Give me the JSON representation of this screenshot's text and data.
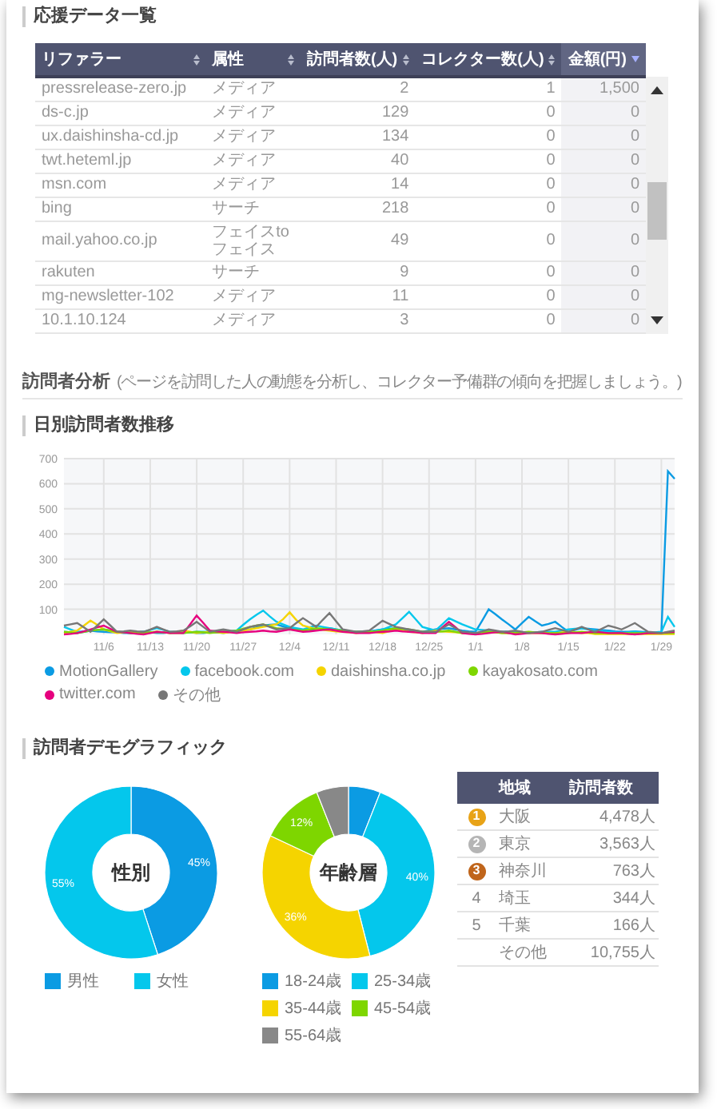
{
  "support_section": {
    "title": "応援データ一覧",
    "columns": [
      {
        "label": "リファラー",
        "sorted": false
      },
      {
        "label": "属性",
        "sorted": false
      },
      {
        "label": "訪問者数(人)",
        "sorted": false
      },
      {
        "label": "コレクター数(人)",
        "sorted": false
      },
      {
        "label": "金額(円)",
        "sorted": true
      }
    ],
    "rows": [
      [
        "pressrelease-zero.jp",
        "メディア",
        "2",
        "1",
        "1,500"
      ],
      [
        "ds-c.jp",
        "メディア",
        "129",
        "0",
        "0"
      ],
      [
        "ux.daishinsha-cd.jp",
        "メディア",
        "134",
        "0",
        "0"
      ],
      [
        "twt.heteml.jp",
        "メディア",
        "40",
        "0",
        "0"
      ],
      [
        "msn.com",
        "メディア",
        "14",
        "0",
        "0"
      ],
      [
        "bing",
        "サーチ",
        "218",
        "0",
        "0"
      ],
      [
        "mail.yahoo.co.jp",
        "フェイスtoフェイス",
        "49",
        "0",
        "0"
      ],
      [
        "rakuten",
        "サーチ",
        "9",
        "0",
        "0"
      ],
      [
        "mg-newsletter-102",
        "メディア",
        "11",
        "0",
        "0"
      ],
      [
        "10.1.10.124",
        "メディア",
        "3",
        "0",
        "0"
      ]
    ]
  },
  "visitor_analysis": {
    "title": "訪問者分析",
    "subtitle": "(ページを訪問した人の動態を分析し、コレクター予備群の傾向を把握しましょう。)",
    "daily_visitors": {
      "title": "日別訪問者数推移",
      "chart_data": {
        "type": "line",
        "categories": [
          null,
          null,
          null,
          null,
          null,
          null,
          "11/6",
          null,
          null,
          null,
          null,
          null,
          null,
          "11/13",
          null,
          null,
          null,
          null,
          null,
          null,
          "11/20",
          null,
          null,
          null,
          null,
          null,
          null,
          "11/27",
          null,
          null,
          null,
          null,
          null,
          null,
          "12/4",
          null,
          null,
          null,
          null,
          null,
          null,
          "12/11",
          null,
          null,
          null,
          null,
          null,
          null,
          "12/18",
          null,
          null,
          null,
          null,
          null,
          null,
          "12/25",
          null,
          null,
          null,
          null,
          null,
          null,
          "1/1",
          null,
          null,
          null,
          null,
          null,
          null,
          "1/8",
          null,
          null,
          null,
          null,
          null,
          null,
          "1/15",
          null,
          null,
          null,
          null,
          null,
          null,
          "1/22",
          null,
          null,
          null,
          null,
          null,
          null,
          "1/29",
          null,
          null
        ],
        "ylim": [
          0,
          700
        ],
        "yticks": [
          100,
          200,
          300,
          400,
          500,
          600,
          700
        ],
        "grid": true,
        "series": [
          {
            "name": "MotionGallery",
            "color": "#0b9be3",
            "values": [
              10,
              8,
              5,
              10,
              15,
              12,
              10,
              9,
              8,
              6,
              5,
              8,
              10,
              8,
              5,
              6,
              8,
              10,
              12,
              8,
              5,
              6,
              8,
              9,
              10,
              12,
              15,
              18,
              20,
              28,
              35,
              38,
              40,
              32,
              25,
              20,
              15,
              18,
              20,
              22,
              25,
              20,
              15,
              12,
              10,
              11,
              12,
              16,
              20,
              22,
              25,
              20,
              15,
              12,
              10,
              15,
              20,
              22,
              25,
              20,
              15,
              12,
              10,
              55,
              100,
              80,
              60,
              40,
              20,
              45,
              70,
              52,
              35,
              42,
              50,
              30,
              10,
              18,
              25,
              22,
              20,
              18,
              15,
              12,
              10,
              11,
              12,
              10,
              8,
              6,
              5,
              650,
              620
            ]
          },
          {
            "name": "facebook.com",
            "color": "#04c7ec",
            "values": [
              30,
              20,
              10,
              12,
              15,
              18,
              20,
              15,
              10,
              8,
              5,
              8,
              10,
              18,
              25,
              18,
              10,
              8,
              5,
              8,
              10,
              10,
              10,
              8,
              5,
              10,
              15,
              38,
              60,
              78,
              95,
              72,
              50,
              40,
              30,
              25,
              20,
              28,
              35,
              30,
              25,
              20,
              15,
              12,
              10,
              10,
              10,
              15,
              20,
              30,
              40,
              65,
              90,
              60,
              30,
              22,
              15,
              40,
              65,
              52,
              40,
              30,
              20,
              18,
              15,
              12,
              10,
              10,
              10,
              8,
              5,
              8,
              10,
              10,
              10,
              15,
              20,
              22,
              25,
              20,
              15,
              12,
              10,
              8,
              5,
              8,
              10,
              8,
              5,
              8,
              10,
              70,
              30
            ]
          },
          {
            "name": "daishinsha.co.jp",
            "color": "#f5d400",
            "values": [
              5,
              10,
              15,
              35,
              55,
              38,
              20,
              12,
              5,
              8,
              10,
              8,
              5,
              8,
              10,
              8,
              5,
              10,
              15,
              10,
              5,
              8,
              10,
              8,
              5,
              8,
              10,
              15,
              20,
              25,
              30,
              35,
              40,
              60,
              88,
              58,
              35,
              28,
              20,
              18,
              15,
              12,
              10,
              8,
              5,
              8,
              10,
              8,
              5,
              12,
              20,
              15,
              10,
              8,
              5,
              10,
              15,
              12,
              10,
              8,
              5,
              5,
              5,
              8,
              10,
              8,
              5,
              5,
              5,
              5,
              5,
              5,
              5,
              5,
              5,
              8,
              10,
              8,
              5,
              5,
              1,
              1,
              1,
              1,
              1,
              1,
              1,
              1,
              1,
              1,
              1,
              1,
              1
            ]
          },
          {
            "name": "kayakosato.com",
            "color": "#7ed600",
            "values": [
              10,
              8,
              5,
              10,
              15,
              18,
              20,
              15,
              10,
              8,
              5,
              5,
              5,
              8,
              10,
              8,
              5,
              5,
              5,
              8,
              10,
              8,
              5,
              8,
              10,
              12,
              15,
              22,
              30,
              35,
              40,
              32,
              25,
              22,
              20,
              18,
              15,
              20,
              25,
              22,
              20,
              18,
              15,
              12,
              10,
              10,
              10,
              12,
              15,
              20,
              25,
              22,
              20,
              15,
              10,
              10,
              10,
              12,
              15,
              10,
              5,
              5,
              5,
              8,
              10,
              8,
              5,
              5,
              5,
              8,
              10,
              8,
              5,
              5,
              5,
              5,
              5,
              8,
              10,
              8,
              5,
              5,
              5,
              5,
              5,
              5,
              5,
              5,
              5,
              5,
              5,
              5,
              5
            ]
          },
          {
            "name": "twitter.com",
            "color": "#e6007e",
            "values": [
              0,
              2,
              5,
              12,
              20,
              28,
              35,
              22,
              10,
              8,
              5,
              2,
              0,
              5,
              10,
              8,
              5,
              5,
              5,
              40,
              75,
              45,
              15,
              12,
              10,
              8,
              5,
              8,
              10,
              12,
              15,
              12,
              10,
              15,
              20,
              15,
              10,
              12,
              15,
              18,
              20,
              15,
              10,
              8,
              5,
              5,
              5,
              8,
              10,
              12,
              15,
              12,
              10,
              8,
              5,
              5,
              5,
              28,
              50,
              28,
              5,
              2,
              0,
              2,
              5,
              8,
              10,
              5,
              0,
              2,
              5,
              5,
              5,
              2,
              0,
              2,
              5,
              5,
              5,
              8,
              10,
              8,
              5,
              5,
              5,
              2,
              0,
              2,
              5,
              5,
              5,
              8,
              10
            ]
          },
          {
            "name": "その他",
            "color": "#777777",
            "values": [
              35,
              40,
              45,
              28,
              10,
              35,
              60,
              35,
              10,
              12,
              15,
              12,
              10,
              20,
              30,
              20,
              10,
              12,
              15,
              32,
              50,
              30,
              10,
              15,
              20,
              15,
              10,
              20,
              30,
              35,
              40,
              30,
              20,
              22,
              25,
              45,
              65,
              48,
              30,
              58,
              85,
              52,
              20,
              15,
              10,
              12,
              15,
              35,
              55,
              42,
              30,
              25,
              20,
              15,
              10,
              10,
              10,
              25,
              40,
              25,
              10,
              8,
              5,
              12,
              20,
              15,
              10,
              12,
              15,
              10,
              5,
              8,
              10,
              18,
              25,
              18,
              10,
              20,
              30,
              20,
              10,
              22,
              35,
              28,
              20,
              32,
              45,
              28,
              10,
              8,
              5,
              10,
              15
            ]
          }
        ]
      }
    }
  },
  "demographics": {
    "title": "訪問者デモグラフィック",
    "gender_chart": {
      "chart_data": {
        "type": "donut",
        "title": "性別",
        "categories": [
          "男性",
          "女性"
        ],
        "values": [
          45,
          55
        ],
        "colors": [
          "#0b9be3",
          "#04c7ec"
        ],
        "value_labels": [
          "45%",
          "55%"
        ]
      }
    },
    "age_chart": {
      "chart_data": {
        "type": "donut",
        "title": "年齢層",
        "categories": [
          "18-24歳",
          "25-34歳",
          "35-44歳",
          "45-54歳",
          "55-64歳"
        ],
        "values": [
          6,
          40,
          36,
          12,
          6
        ],
        "colors": [
          "#0b9be3",
          "#04c7ec",
          "#f5d400",
          "#7ed600",
          "#888888"
        ],
        "value_labels": [
          null,
          "40%",
          "36%",
          "12%",
          null
        ]
      }
    },
    "region_table": {
      "columns": [
        "地域",
        "訪問者数"
      ],
      "rows": [
        {
          "kind": "medal",
          "rank": "1",
          "color": "#e8a317",
          "region": "大阪",
          "visitors": "4,478人"
        },
        {
          "kind": "medal",
          "rank": "2",
          "color": "#b5b5b5",
          "region": "東京",
          "visitors": "3,563人"
        },
        {
          "kind": "medal",
          "rank": "3",
          "color": "#c0651b",
          "region": "神奈川",
          "visitors": "763人"
        },
        {
          "kind": "plain",
          "rank": "4",
          "region": "埼玉",
          "visitors": "344人"
        },
        {
          "kind": "plain",
          "rank": "5",
          "region": "千葉",
          "visitors": "166人"
        },
        {
          "kind": "none",
          "region": "その他",
          "visitors": "10,755人"
        }
      ]
    }
  }
}
